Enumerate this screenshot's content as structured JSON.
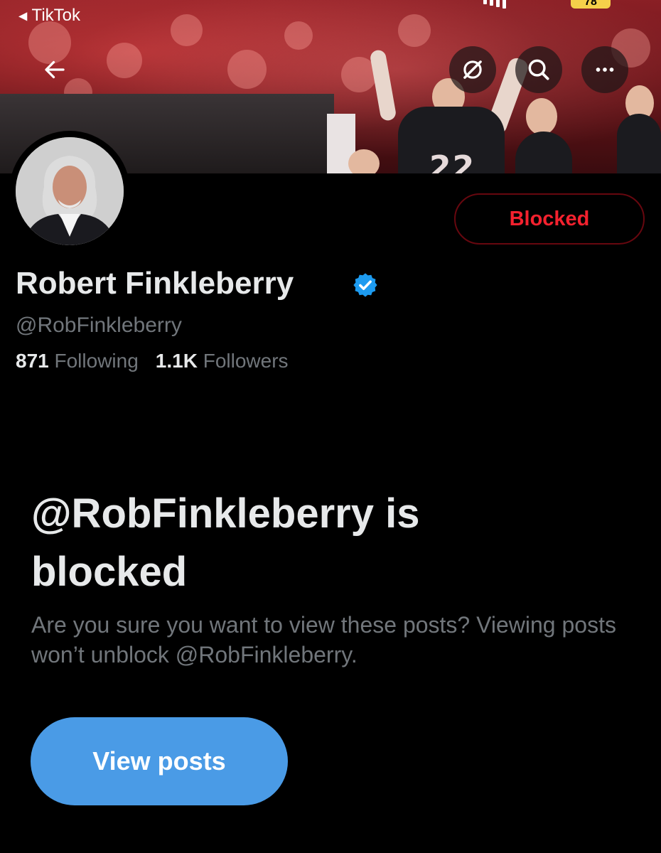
{
  "status_bar": {
    "back_app_label": "TikTok",
    "battery": "78"
  },
  "nav": {
    "back_icon": "arrow-left-icon",
    "hide_icon": "eye-slash-icon",
    "search_icon": "search-icon",
    "more_icon": "more-horizontal-icon"
  },
  "profile": {
    "display_name": "Robert Finkleberry",
    "verified_icon": "verified-badge-icon",
    "handle": "@RobFinkleberry",
    "following_count": "871",
    "following_label": "Following",
    "followers_count": "1.1K",
    "followers_label": "Followers",
    "blocked_button_label": "Blocked"
  },
  "blocked_notice": {
    "title": "@RobFinkleberry is blocked",
    "description": "Are you sure you want to view these posts? Viewing posts won’t unblock @RobFinkleberry.",
    "view_button_label": "View posts"
  },
  "banner": {
    "jersey_number": "22"
  },
  "colors": {
    "background": "#000000",
    "blocked_red": "#f4212e",
    "accent_blue": "#4a9be6",
    "secondary_text": "#71767b",
    "verified_blue": "#1d9bf0"
  }
}
